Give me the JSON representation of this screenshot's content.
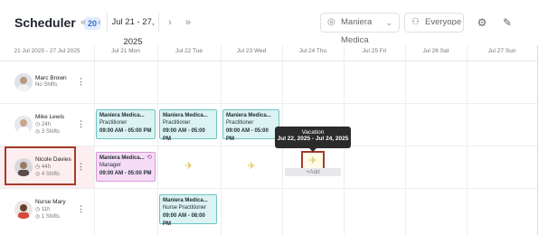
{
  "header": {
    "title": "Scheduler",
    "count": "20",
    "date_range": "Jul 21 - 27, 2025",
    "location_select": "Maniera Medica",
    "people_select": "Everyone"
  },
  "columns": {
    "range": "21 Jul 2025 - 27 Jul 2025",
    "days": [
      "Jul 21 Mon",
      "Jul 22 Tue",
      "Jul 23 Wed",
      "Jul 24 Thu",
      "Jul 25 Fri",
      "Jul 26 Sat",
      "Jul 27 Sun"
    ]
  },
  "users": [
    {
      "name": "Marc Brown",
      "hours": "",
      "shifts": "No Shifts"
    },
    {
      "name": "Mike Lewis",
      "hours": "24h",
      "shifts": "3 Shifts"
    },
    {
      "name": "Nicole Davies",
      "hours": "44h",
      "shifts": "4 Shifts"
    },
    {
      "name": "Nurse Mary",
      "hours": "11h",
      "shifts": "1 Shifts"
    }
  ],
  "shifts": {
    "mike_mon": {
      "loc": "Maniera Medica...",
      "role": "Practitioner",
      "time": "09:00 AM - 05:00 PM"
    },
    "mike_tue": {
      "loc": "Maniera Medica...",
      "role": "Practitioner",
      "time": "09:00 AM - 05:00 PM"
    },
    "mike_wed": {
      "loc": "Maniera Medica...",
      "role": "Practitioner",
      "time": "09:00 AM - 05:00 PM"
    },
    "nicole_mon": {
      "loc": "Maniera Medica...",
      "role": "Manager",
      "time": "09:00 AM - 05:00 PM"
    },
    "mary_tue": {
      "loc": "Maniera Medica...",
      "role": "Nurse Practitioner",
      "time": "09:00 AM - 08:00 PM"
    }
  },
  "tooltip": {
    "title": "Vacation",
    "dates": "Jul 22, 2025 - Jul 24, 2025"
  },
  "add_label": "+Add",
  "icons": {
    "vacation": "airplane-icon",
    "calendar_range": "double-chevron-icon",
    "location": "pin-icon",
    "people": "users-icon",
    "settings": "settings-icon",
    "wrench": "tools-icon"
  },
  "colors": {
    "shift_teal": "#dcf3f3",
    "shift_pink": "#f6dcf6",
    "vacation": "#e3c653",
    "highlight": "#a33b2a"
  }
}
